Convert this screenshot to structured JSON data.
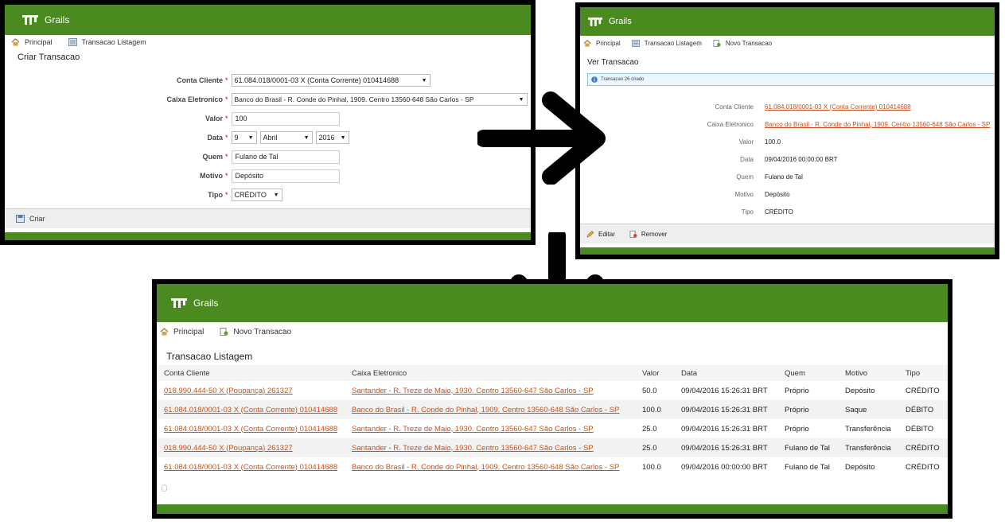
{
  "app": {
    "brand": "Grails"
  },
  "create": {
    "nav": {
      "home": "Principal",
      "list": "Transacao Listagem"
    },
    "title": "Criar Transacao",
    "required_mark": "*",
    "fields": {
      "conta_cliente": {
        "label": "Conta Cliente",
        "value": "61.084.018/0001-03 X (Conta Corrente) 010414688"
      },
      "caixa": {
        "label": "Caixa Eletronico",
        "value": "Banco do Brasil - R. Conde do Pinhal, 1909. Centro 13560-648 São Carlos - SP"
      },
      "valor": {
        "label": "Valor",
        "value": "100"
      },
      "data": {
        "label": "Data",
        "day": "9",
        "month": "Abril",
        "year": "2016"
      },
      "quem": {
        "label": "Quem",
        "value": "Fulano de Tal"
      },
      "motivo": {
        "label": "Motivo",
        "value": "Depósito"
      },
      "tipo": {
        "label": "Tipo",
        "value": "CRÉDITO"
      }
    },
    "create_button": "Criar"
  },
  "show": {
    "nav": {
      "home": "Principal",
      "list": "Transacao Listagem",
      "new": "Novo Transacao"
    },
    "title": "Ver Transacao",
    "message": "Transacao 26 criado",
    "fields": {
      "conta_cliente": {
        "label": "Conta Cliente",
        "value": "61.084.018/0001-03 X (Conta Corrente) 010414688"
      },
      "caixa": {
        "label": "Caixa Eletronico",
        "value": "Banco do Brasil - R. Conde do Pinhal, 1909. Centro 13560-648 São Carlos - SP"
      },
      "valor": {
        "label": "Valor",
        "value": "100.0"
      },
      "data": {
        "label": "Data",
        "value": "09/04/2016 00:00:00 BRT"
      },
      "quem": {
        "label": "Quem",
        "value": "Fulano de Tal"
      },
      "motivo": {
        "label": "Motivo",
        "value": "Depósito"
      },
      "tipo": {
        "label": "Tipo",
        "value": "CRÉDITO"
      }
    },
    "edit_button": "Editar",
    "remove_button": "Remover"
  },
  "list": {
    "nav": {
      "home": "Principal",
      "new": "Novo Transacao"
    },
    "title": "Transacao Listagem",
    "columns": [
      "Conta Cliente",
      "Caixa Eletronico",
      "Valor",
      "Data",
      "Quem",
      "Motivo",
      "Tipo"
    ],
    "rows": [
      [
        "018.990.444-50 X (Poupança) 261327",
        "Santander - R. Treze de Maio, 1930. Centro 13560-647 São Carlos - SP",
        "50.0",
        "09/04/2016 15:26:31 BRT",
        "Próprio",
        "Depósito",
        "CRÉDITO"
      ],
      [
        "61.084.018/0001-03 X (Conta Corrente) 010414688",
        "Banco do Brasil - R. Conde do Pinhal, 1909. Centro 13560-648 São Carlos - SP",
        "100.0",
        "09/04/2016 15:26:31 BRT",
        "Próprio",
        "Saque",
        "DÉBITO"
      ],
      [
        "61.084.018/0001-03 X (Conta Corrente) 010414688",
        "Santander - R. Treze de Maio, 1930. Centro 13560-647 São Carlos - SP",
        "25.0",
        "09/04/2016 15:26:31 BRT",
        "Próprio",
        "Transferência",
        "DÉBITO"
      ],
      [
        "018.990.444-50 X (Poupança) 261327",
        "Santander - R. Treze de Maio, 1930. Centro 13560-647 São Carlos - SP",
        "25.0",
        "09/04/2016 15:26:31 BRT",
        "Fulano de Tal",
        "Transferência",
        "CRÉDITO"
      ],
      [
        "61.084.018/0001-03 X (Conta Corrente) 010414688",
        "Banco do Brasil - R. Conde do Pinhal, 1909. Centro 13560-648 São Carlos - SP",
        "100.0",
        "09/04/2016 00:00:00 BRT",
        "Fulano de Tal",
        "Depósito",
        "CRÉDITO"
      ]
    ]
  },
  "colors": {
    "header_green": "#4a8a1e",
    "link": "#c8501a",
    "required": "#cc0000",
    "frame": "#000000"
  },
  "icons": [
    "grails-logo-icon",
    "home-icon",
    "list-icon",
    "new-icon",
    "save-icon",
    "info-icon",
    "edit-icon",
    "remove-icon",
    "arrow-right-icon",
    "arrow-down-icon"
  ]
}
